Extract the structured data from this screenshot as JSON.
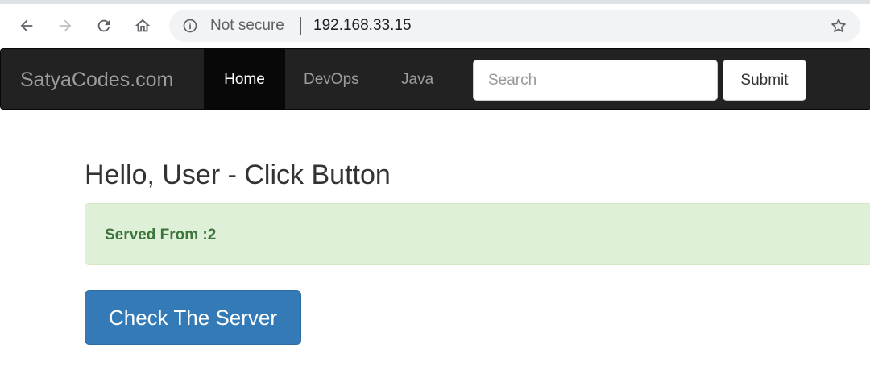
{
  "browser": {
    "security_status": "Not secure",
    "url": "192.168.33.15",
    "icons": [
      "back-icon",
      "forward-icon",
      "reload-icon",
      "home-icon",
      "info-icon",
      "star-icon"
    ]
  },
  "navbar": {
    "brand": "SatyaCodes.com",
    "items": [
      {
        "label": "Home",
        "active": true
      },
      {
        "label": "DevOps",
        "active": false
      },
      {
        "label": "Java",
        "active": false
      }
    ],
    "search_placeholder": "Search",
    "search_value": "",
    "submit_label": "Submit"
  },
  "main": {
    "heading": "Hello, User - Click Button",
    "alert_text": "Served From :2",
    "button_label": "Check The Server"
  },
  "colors": {
    "navbar_bg": "#222222",
    "alert_bg": "#dff0d8",
    "alert_text": "#3c763d",
    "primary_button": "#337ab7"
  }
}
